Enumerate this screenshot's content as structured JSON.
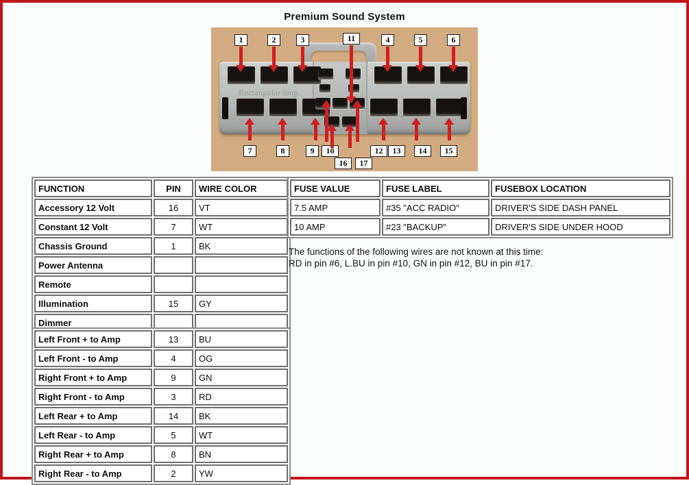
{
  "title": "Premium Sound System",
  "connector": {
    "watermark": "Rectangular 8mp",
    "top_pins": [
      "1",
      "2",
      "3",
      "11",
      "4",
      "5",
      "6"
    ],
    "bottom_pins": [
      "7",
      "8",
      "9",
      "10",
      "16",
      "17",
      "12",
      "13",
      "14",
      "15"
    ],
    "accent_color": "#cf2020",
    "background_color": "#d3ab80"
  },
  "function_table": {
    "headers": [
      "FUNCTION",
      "PIN",
      "WIRE COLOR"
    ],
    "rows": [
      {
        "function": "Accessory 12 Volt",
        "pin": "16",
        "color": "VT"
      },
      {
        "function": "Constant 12 Volt",
        "pin": "7",
        "color": "WT"
      },
      {
        "function": "Chassis Ground",
        "pin": "1",
        "color": "BK"
      },
      {
        "function": "Power Antenna",
        "pin": "",
        "color": ""
      },
      {
        "function": "Remote",
        "pin": "",
        "color": ""
      },
      {
        "function": "Illumination",
        "pin": "15",
        "color": "GY"
      },
      {
        "function": "Dimmer",
        "pin": "",
        "color": ""
      }
    ]
  },
  "amp_table": {
    "rows": [
      {
        "function": "Left Front + to Amp",
        "pin": "13",
        "color": "BU"
      },
      {
        "function": "Left Front - to Amp",
        "pin": "4",
        "color": "OG"
      },
      {
        "function": "Right Front + to Amp",
        "pin": "9",
        "color": "GN"
      },
      {
        "function": "Right Front - to Amp",
        "pin": "3",
        "color": "RD"
      },
      {
        "function": "Left Rear + to Amp",
        "pin": "14",
        "color": "BK"
      },
      {
        "function": "Left Rear - to Amp",
        "pin": "5",
        "color": "WT"
      },
      {
        "function": "Right Rear + to Amp",
        "pin": "8",
        "color": "BN"
      },
      {
        "function": "Right Rear - to Amp",
        "pin": "2",
        "color": "YW"
      }
    ]
  },
  "fuse_table": {
    "headers": [
      "FUSE VALUE",
      "FUSE LABEL",
      "FUSEBOX LOCATION"
    ],
    "rows": [
      {
        "value": "7.5 AMP",
        "label": "#35 \"ACC RADIO\"",
        "location": "DRIVER'S SIDE DASH PANEL"
      },
      {
        "value": "10 AMP",
        "label": "#23 \"BACKUP\"",
        "location": "DRIVER'S SIDE UNDER HOOD"
      }
    ]
  },
  "note": {
    "line1": "The functions of the following wires are not known at this time:",
    "line2": "RD in pin #6, L.BU in pin #10, GN in pin #12, BU in pin #17."
  }
}
